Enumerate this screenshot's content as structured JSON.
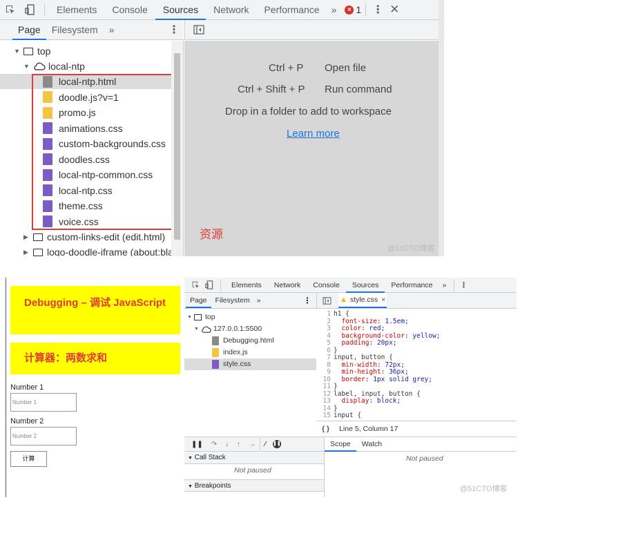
{
  "top_panel": {
    "tabs": [
      "Elements",
      "Console",
      "Sources",
      "Network",
      "Performance"
    ],
    "active_tab": "Sources",
    "more": "»",
    "error_count": "1",
    "subtabs": [
      "Page",
      "Filesystem"
    ],
    "subtab_more": "»",
    "tree": {
      "top": "top",
      "origin": "local-ntp",
      "files": [
        {
          "name": "local-ntp.html",
          "kind": "html"
        },
        {
          "name": "doodle.js?v=1",
          "kind": "js"
        },
        {
          "name": "promo.js",
          "kind": "js"
        },
        {
          "name": "animations.css",
          "kind": "css"
        },
        {
          "name": "custom-backgrounds.css",
          "kind": "css"
        },
        {
          "name": "doodles.css",
          "kind": "css"
        },
        {
          "name": "local-ntp-common.css",
          "kind": "css"
        },
        {
          "name": "local-ntp.css",
          "kind": "css"
        },
        {
          "name": "theme.css",
          "kind": "css"
        },
        {
          "name": "voice.css",
          "kind": "css"
        }
      ],
      "frames": [
        "custom-links-edit (edit.html)",
        "logo-doodle-iframe (about:bla"
      ]
    },
    "annotation": "资源",
    "shortcuts": [
      {
        "keys": "Ctrl + P",
        "action": "Open file"
      },
      {
        "keys": "Ctrl + Shift + P",
        "action": "Run command"
      }
    ],
    "drop_text": "Drop in a folder to add to workspace",
    "learn_more": "Learn more",
    "watermark": "@51CTO博客"
  },
  "app": {
    "title": "Debugging – 调试 JavaScript",
    "subtitle": "计算器：两数求和",
    "label1": "Number 1",
    "placeholder1": "Number 1",
    "label2": "Number 2",
    "placeholder2": "Number 2",
    "button": "计算"
  },
  "bottom_devtools": {
    "tabs": [
      "Elements",
      "Network",
      "Console",
      "Sources",
      "Performance"
    ],
    "active_tab": "Sources",
    "more": "»",
    "subtabs": [
      "Page",
      "Filesystem"
    ],
    "subtab_more": "»",
    "open_file_tab": "style.css",
    "tree": {
      "top": "top",
      "origin": "127.0.0.1:5500",
      "files": [
        {
          "name": "Debugging.html",
          "kind": "html"
        },
        {
          "name": "index.js",
          "kind": "js"
        },
        {
          "name": "style.css",
          "kind": "css"
        }
      ]
    },
    "code_lines": [
      {
        "n": "1",
        "t": "h1 {"
      },
      {
        "n": "2",
        "t": "  font-size: 1.5em;"
      },
      {
        "n": "3",
        "t": "  color: red;"
      },
      {
        "n": "4",
        "t": "  background-color: yellow;"
      },
      {
        "n": "5",
        "t": "  padding: 20px;"
      },
      {
        "n": "6",
        "t": "}"
      },
      {
        "n": "7",
        "t": "input, button {"
      },
      {
        "n": "8",
        "t": "  min-width: 72px;"
      },
      {
        "n": "9",
        "t": "  min-height: 36px;"
      },
      {
        "n": "10",
        "t": "  border: 1px solid grey;"
      },
      {
        "n": "11",
        "t": "}"
      },
      {
        "n": "12",
        "t": "label, input, button {"
      },
      {
        "n": "13",
        "t": "  display: block;"
      },
      {
        "n": "14",
        "t": "}"
      },
      {
        "n": "15",
        "t": "input {"
      }
    ],
    "status": "Line 5, Column 17",
    "status_icon": "{ }",
    "call_stack": "Call Stack",
    "not_paused": "Not paused",
    "breakpoints": "Breakpoints",
    "scope_tabs": [
      "Scope",
      "Watch"
    ],
    "scope_not_paused": "Not paused",
    "watermark": "@51CTO博客"
  },
  "colors": {
    "html_file": "#8a8a8a",
    "js_file": "#f4c542",
    "css_file": "#7c5cc4",
    "highlight_box": "#e53935",
    "accent": "#1a73e8"
  }
}
